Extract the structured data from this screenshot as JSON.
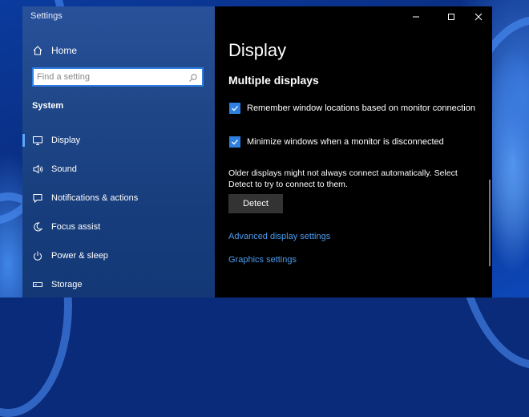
{
  "window": {
    "title": "Settings"
  },
  "sidebar": {
    "home_label": "Home",
    "search_placeholder": "Find a setting",
    "section": "System",
    "items": [
      {
        "label": "Display",
        "icon": "monitor-icon",
        "active": true
      },
      {
        "label": "Sound",
        "icon": "speaker-icon"
      },
      {
        "label": "Notifications & actions",
        "icon": "message-icon"
      },
      {
        "label": "Focus assist",
        "icon": "moon-icon"
      },
      {
        "label": "Power & sleep",
        "icon": "power-icon"
      },
      {
        "label": "Storage",
        "icon": "drive-icon"
      }
    ]
  },
  "main": {
    "title": "Display",
    "subtitle": "Multiple displays",
    "checkboxes": [
      {
        "label": "Remember window locations based on monitor connection",
        "checked": true
      },
      {
        "label": "Minimize windows when a monitor is disconnected",
        "checked": true
      }
    ],
    "description": "Older displays might not always connect automatically. Select Detect to try to connect to them.",
    "detect_label": "Detect",
    "links": [
      "Advanced display settings",
      "Graphics settings"
    ]
  },
  "colors": {
    "accent": "#2f7fe0",
    "link": "#4a9cf0",
    "sidebar": "#1f4788",
    "content_bg": "#000000"
  }
}
